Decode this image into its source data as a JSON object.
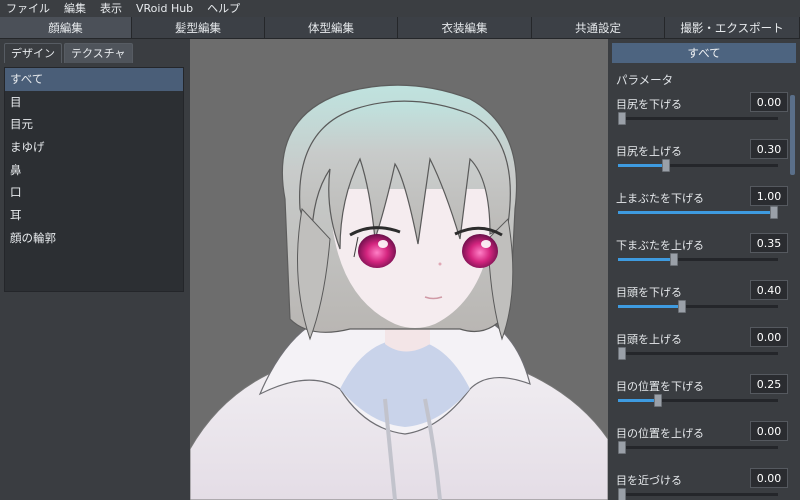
{
  "menu": [
    "ファイル",
    "編集",
    "表示",
    "VRoid Hub",
    "ヘルプ"
  ],
  "main_tabs": [
    {
      "label": "顔編集",
      "active": true
    },
    {
      "label": "髪型編集",
      "active": false
    },
    {
      "label": "体型編集",
      "active": false
    },
    {
      "label": "衣装編集",
      "active": false
    },
    {
      "label": "共通設定",
      "active": false
    },
    {
      "label": "撮影・エクスポート",
      "active": false
    }
  ],
  "left": {
    "subtabs": [
      {
        "label": "デザイン",
        "active": false
      },
      {
        "label": "テクスチャ",
        "active": true
      }
    ],
    "categories": [
      {
        "label": "すべて",
        "selected": true
      },
      {
        "label": "目",
        "selected": false
      },
      {
        "label": "目元",
        "selected": false
      },
      {
        "label": "まゆげ",
        "selected": false
      },
      {
        "label": "鼻",
        "selected": false
      },
      {
        "label": "口",
        "selected": false
      },
      {
        "label": "耳",
        "selected": false
      },
      {
        "label": "顔の輪郭",
        "selected": false
      }
    ]
  },
  "right": {
    "header": "すべて",
    "section": "パラメータ",
    "params": [
      {
        "label": "目尻を下げる",
        "value": "0.00",
        "level": 0.0
      },
      {
        "label": "目尻を上げる",
        "value": "0.30",
        "level": 0.3
      },
      {
        "label": "上まぶたを下げる",
        "value": "1.00",
        "level": 1.0
      },
      {
        "label": "下まぶたを上げる",
        "value": "0.35",
        "level": 0.35
      },
      {
        "label": "目頭を下げる",
        "value": "0.40",
        "level": 0.4
      },
      {
        "label": "目頭を上げる",
        "value": "0.00",
        "level": 0.0
      },
      {
        "label": "目の位置を下げる",
        "value": "0.25",
        "level": 0.25
      },
      {
        "label": "目の位置を上げる",
        "value": "0.00",
        "level": 0.0
      },
      {
        "label": "目を近づける",
        "value": "0.00",
        "level": 0.0
      }
    ]
  },
  "colors": {
    "accent": "#3e9be0",
    "selected_row": "#4a5e78",
    "viewport_bg": "#6d6d6d",
    "hair": "#c9cccb",
    "eye": "#d4257f"
  }
}
